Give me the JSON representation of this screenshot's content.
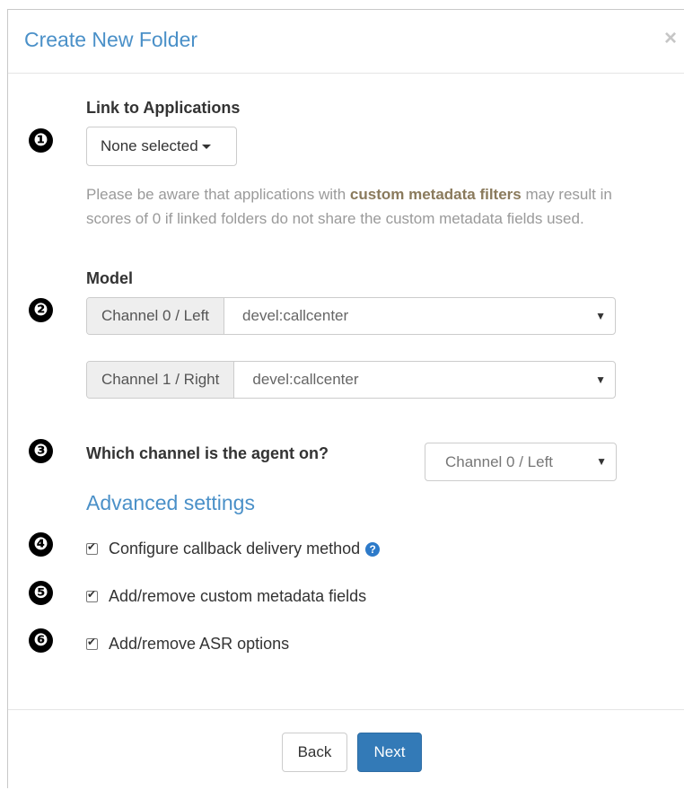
{
  "dialog": {
    "title": "Create New Folder",
    "close_glyph": "×"
  },
  "steps": [
    "❶",
    "❷",
    "❸",
    "❹",
    "❺",
    "❻"
  ],
  "link_section": {
    "label": "Link to Applications",
    "dropdown_value": "None selected",
    "notice_pre": "Please be aware that applications with ",
    "notice_bold": "custom metadata filters",
    "notice_post": " may result in scores of 0 if linked folders do not share the custom metadata fields used."
  },
  "model_section": {
    "label": "Model",
    "channels": [
      {
        "addon": "Channel 0 / Left",
        "value": "devel:callcenter"
      },
      {
        "addon": "Channel 1 / Right",
        "value": "devel:callcenter"
      }
    ]
  },
  "agent_section": {
    "question": "Which channel is the agent on?",
    "selected": "Channel 0 / Left"
  },
  "advanced_link": "Advanced settings",
  "options": [
    {
      "label": "Configure callback delivery method",
      "checked": true,
      "help": "?"
    },
    {
      "label": "Add/remove custom metadata fields",
      "checked": true
    },
    {
      "label": "Add/remove ASR options",
      "checked": true
    }
  ],
  "footer": {
    "back_label": "Back",
    "next_label": "Next"
  },
  "colors": {
    "accent": "#4a90c8",
    "primary_button": "#337ab7",
    "notice_text": "#9a9a9a"
  }
}
